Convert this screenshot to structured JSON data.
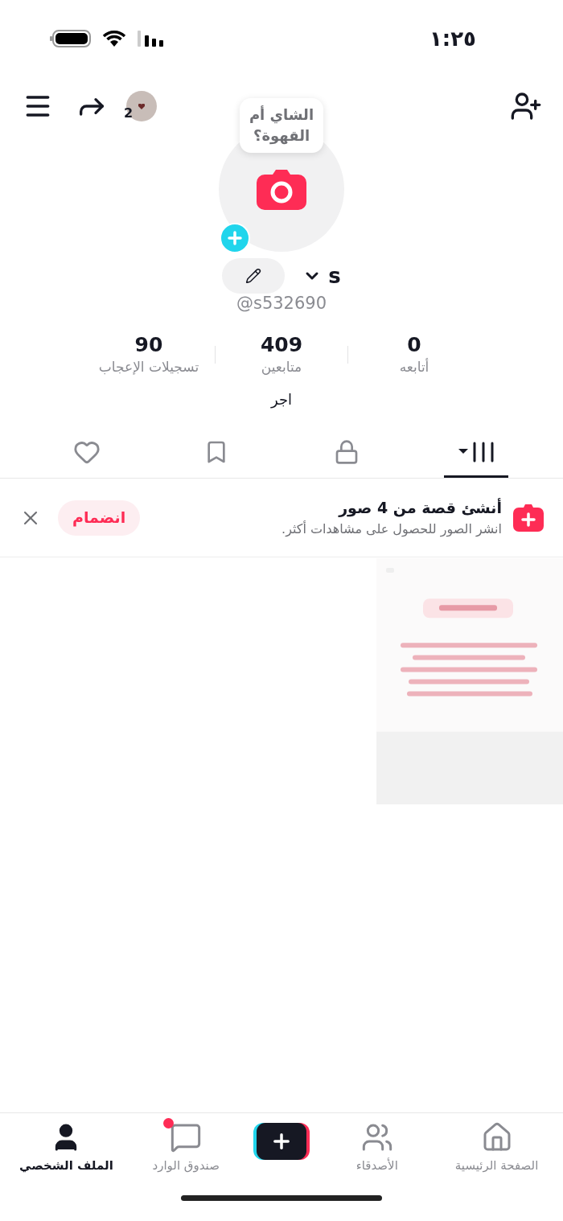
{
  "status_bar": {
    "time": "١:٢٥"
  },
  "header": {
    "avatar_count": "2"
  },
  "profile": {
    "tooltip": "الشاي أم القهوة؟",
    "name": "s",
    "handle": "@s532690",
    "bio": "اجر"
  },
  "stats": [
    {
      "value": "0",
      "label": "أتابعه"
    },
    {
      "value": "409",
      "label": "متابعين"
    },
    {
      "value": "90",
      "label": "تسجيلات الإعجاب"
    }
  ],
  "tabs": [
    {
      "kind": "videos",
      "selected": true
    },
    {
      "kind": "private",
      "selected": false
    },
    {
      "kind": "saved",
      "selected": false
    },
    {
      "kind": "liked",
      "selected": false
    }
  ],
  "banner": {
    "title": "أنشئ قصة من 4 صور",
    "subtitle": "انشر الصور للحصول على مشاهدات أكثر.",
    "button": "انضمام"
  },
  "nav": [
    {
      "kind": "home",
      "label": "الصفحة الرئيسية",
      "selected": false,
      "dot": false
    },
    {
      "kind": "friends",
      "label": "الأصدقاء",
      "selected": false,
      "dot": false
    },
    {
      "kind": "create",
      "selected": false,
      "dot": false
    },
    {
      "kind": "inbox",
      "label": "صندوق الوارد",
      "selected": false,
      "dot": true
    },
    {
      "kind": "profile",
      "label": "الملف الشخصي",
      "selected": true,
      "dot": false
    }
  ]
}
